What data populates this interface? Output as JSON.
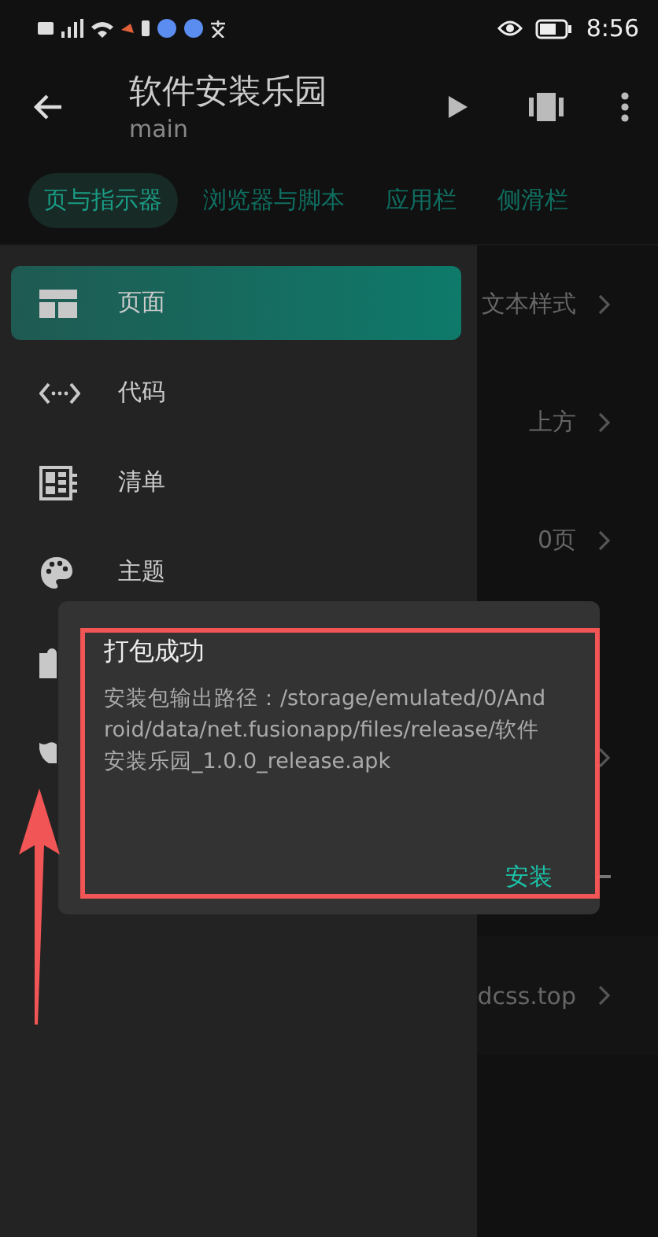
{
  "status_bar": {
    "time": "8:56"
  },
  "app_bar": {
    "title": "软件安装乐园",
    "subtitle": "main"
  },
  "tabs": [
    {
      "label": "页与指示器",
      "selected": true
    },
    {
      "label": "浏览器与脚本",
      "selected": false
    },
    {
      "label": "应用栏",
      "selected": false
    },
    {
      "label": "侧滑栏",
      "selected": false
    }
  ],
  "page_rows": [
    {
      "kind": "value",
      "value": "文本样式"
    },
    {
      "kind": "value",
      "value": "上方"
    },
    {
      "kind": "value",
      "value": "0页"
    },
    {
      "kind": "blank"
    },
    {
      "kind": "chevron"
    },
    {
      "kind": "add"
    },
    {
      "kind": "value",
      "value": "dcss.top"
    }
  ],
  "drawer": {
    "items": [
      {
        "kind": "page",
        "label": "页面",
        "selected": true
      },
      {
        "kind": "code",
        "label": "代码",
        "selected": false
      },
      {
        "kind": "list",
        "label": "清单",
        "selected": false
      },
      {
        "kind": "theme",
        "label": "主题",
        "selected": false
      },
      {
        "kind": "plugin",
        "selected": false
      },
      {
        "kind": "tools",
        "selected": false
      }
    ]
  },
  "dialog": {
    "title": "打包成功",
    "message": "安装包输出路径：/storage/emulated/0/Android/data/net.fusionapp/files/release/软件安装乐园_1.0.0_release.apk",
    "button": "安装"
  }
}
